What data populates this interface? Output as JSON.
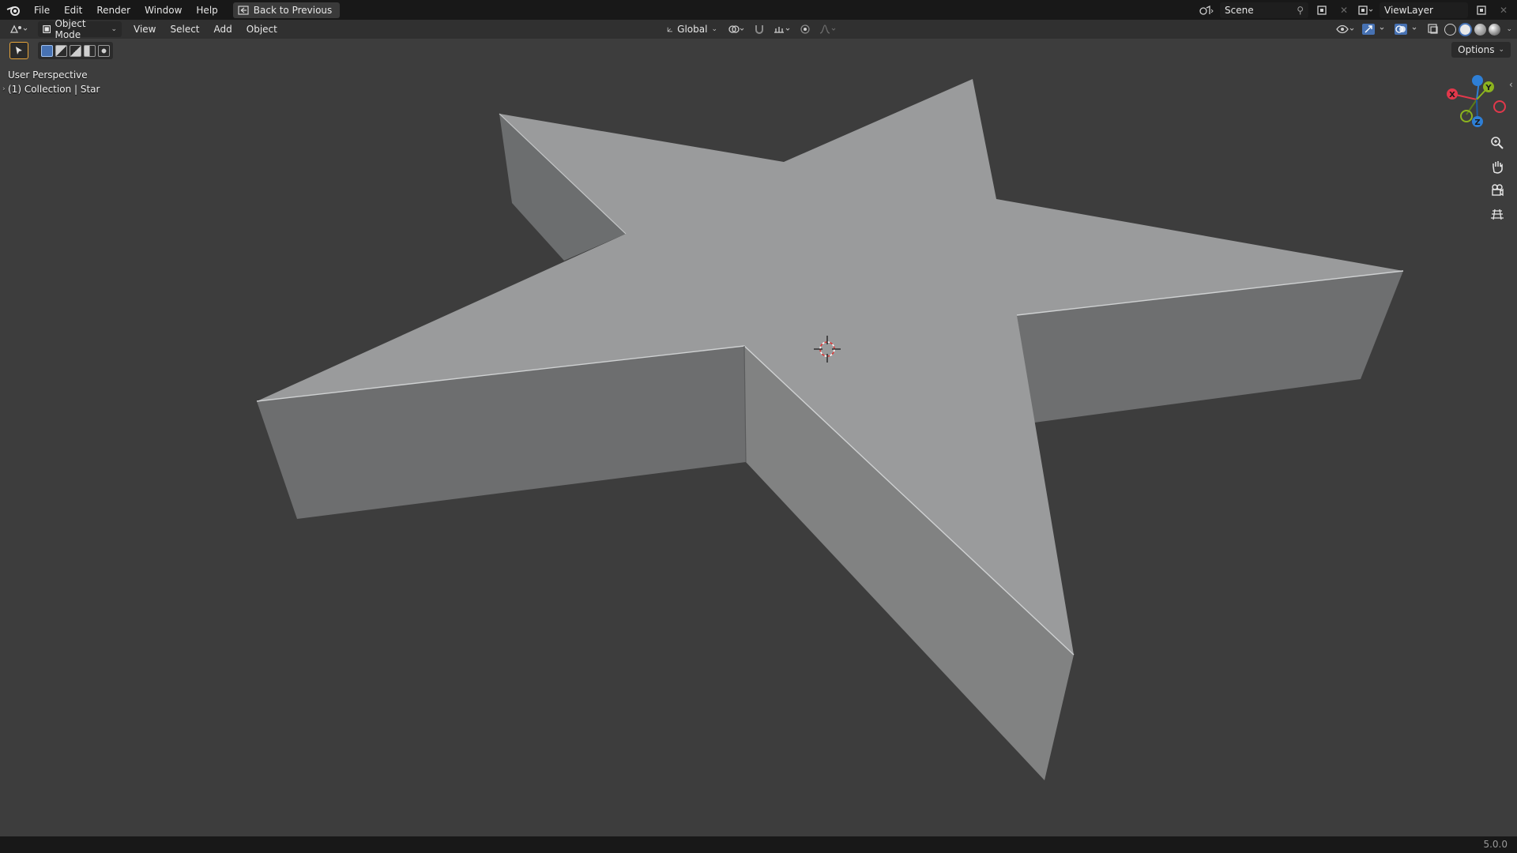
{
  "topbar": {
    "menus": [
      "File",
      "Edit",
      "Render",
      "Window",
      "Help"
    ],
    "back_button": "Back to Previous",
    "scene": "Scene",
    "view_layer": "ViewLayer"
  },
  "header": {
    "mode": "Object Mode",
    "menus": [
      "View",
      "Select",
      "Add",
      "Object"
    ],
    "transform_orientation": "Global",
    "options": "Options"
  },
  "viewport": {
    "perspective": "User Perspective",
    "collection": "(1) Collection | Star",
    "object": "Star",
    "background_color": "#3d3d3d",
    "object_color": "#9a9b9c"
  },
  "gizmo": {
    "x_label": "X",
    "y_label": "Y",
    "z_label": "Z",
    "x_color": "#e2384b",
    "y_color": "#8cb31f",
    "z_color": "#2e7fd6"
  },
  "nav_icons": [
    "zoom-icon",
    "pan-hand-icon",
    "camera-view-icon",
    "grid-view-icon"
  ],
  "status": {
    "version": "5.0.0"
  }
}
